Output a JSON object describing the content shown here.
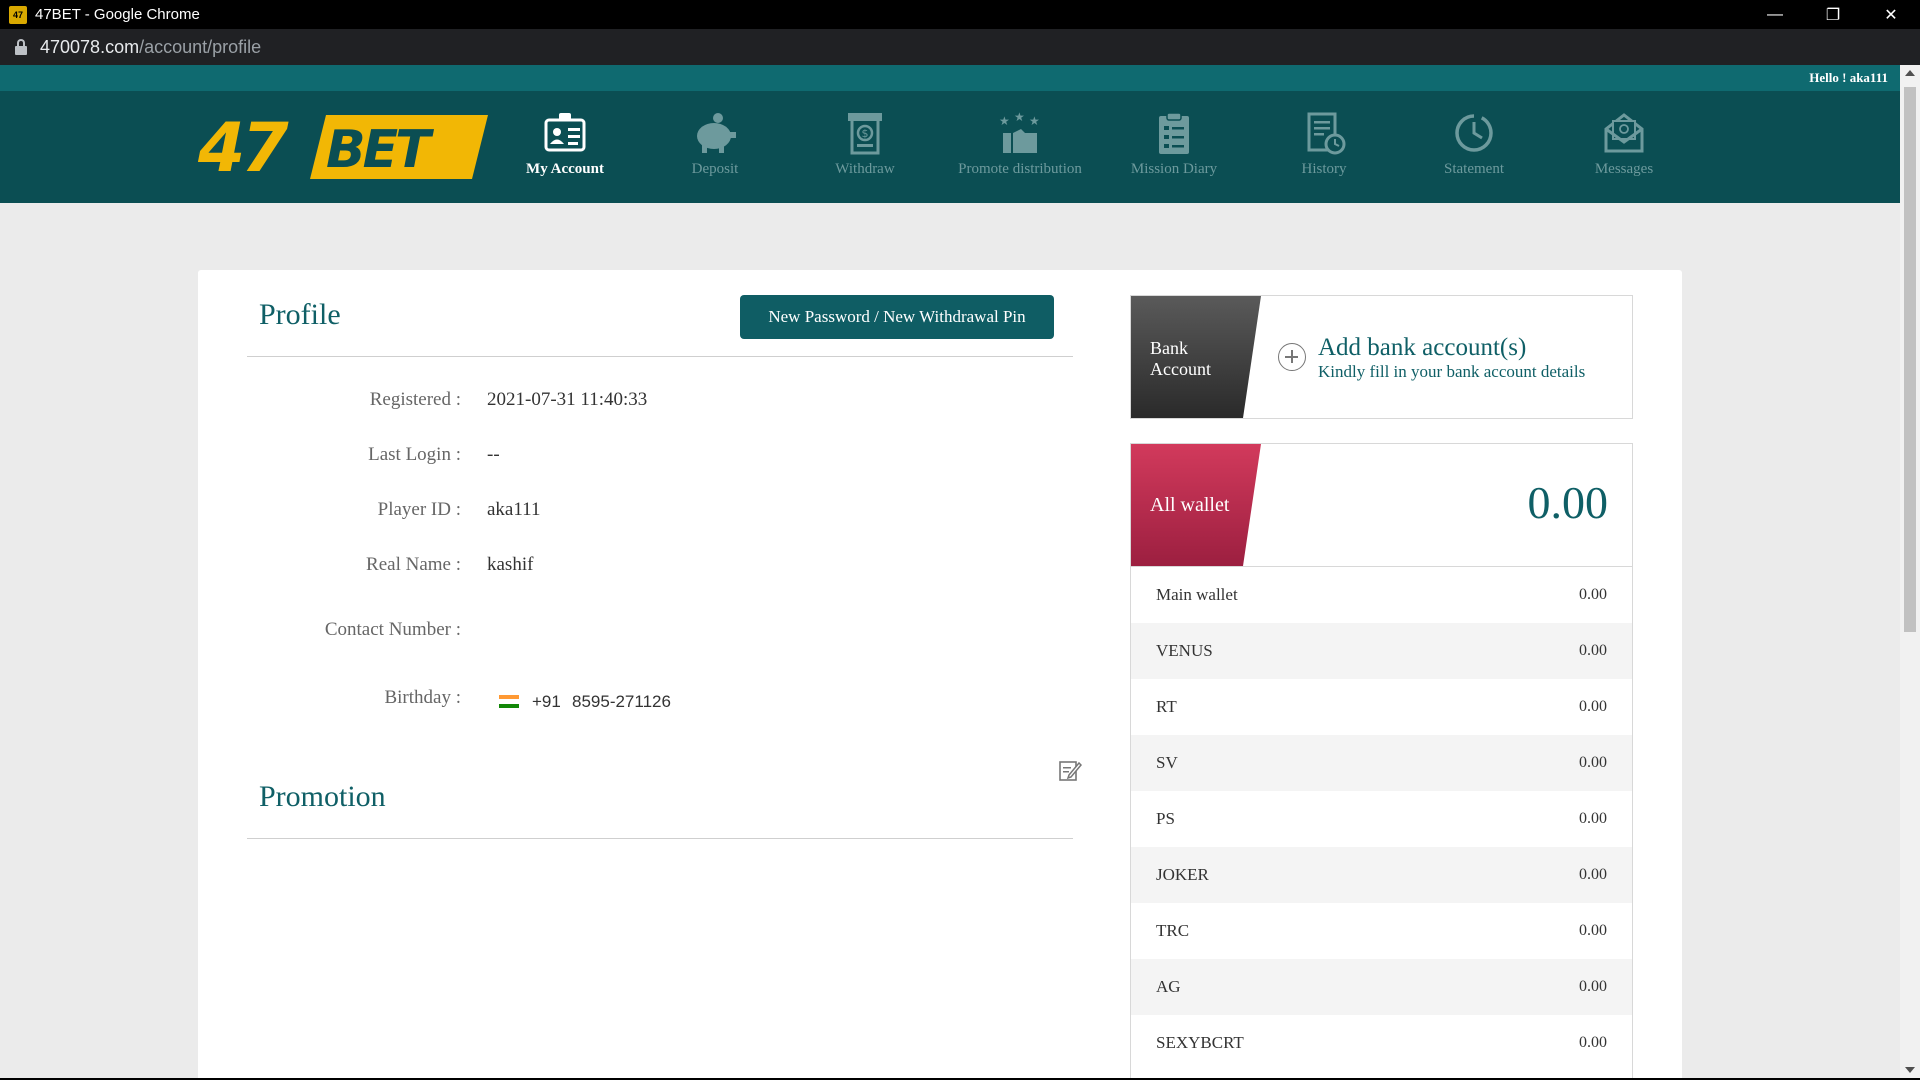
{
  "window": {
    "title": "47BET - Google Chrome",
    "favicon_text": "47",
    "url_host": "470078.com",
    "url_path": "/account/profile"
  },
  "header": {
    "greeting": "Hello ! aka111",
    "logo_text": "47BET",
    "nav": [
      {
        "label": "My Account",
        "icon": "id-card-icon",
        "active": true
      },
      {
        "label": "Deposit",
        "icon": "piggy-bank-icon",
        "active": false
      },
      {
        "label": "Withdraw",
        "icon": "withdraw-cash-icon",
        "active": false
      },
      {
        "label": "Promote distribution",
        "icon": "promote-stars-icon",
        "active": false
      },
      {
        "label": "Mission Diary",
        "icon": "clipboard-checklist-icon",
        "active": false
      },
      {
        "label": "History",
        "icon": "document-clock-icon",
        "active": false
      },
      {
        "label": "Statement",
        "icon": "clock-icon",
        "active": false
      },
      {
        "label": "Messages",
        "icon": "envelope-icon",
        "active": false
      }
    ]
  },
  "profile": {
    "title": "Profile",
    "change_button": "New Password / New Withdrawal Pin",
    "fields": [
      {
        "label": "Registered :",
        "value": "2021-07-31 11:40:33"
      },
      {
        "label": "Last Login :",
        "value": "--"
      },
      {
        "label": "Player ID :",
        "value": "aka111"
      },
      {
        "label": "Real Name :",
        "value": "kashif"
      },
      {
        "label": "Contact Number :",
        "country_code": "+91",
        "value": "8595-271126"
      },
      {
        "label": "Birthday :",
        "value": ""
      }
    ]
  },
  "promotion": {
    "title": "Promotion"
  },
  "bank": {
    "tab_line1": "Bank",
    "tab_line2": "Account",
    "add_title": "Add bank account(s)",
    "add_subtitle": "Kindly fill in your bank account details"
  },
  "wallet": {
    "tab_label": "All wallet",
    "total": "0.00",
    "rows": [
      {
        "name": "Main wallet",
        "value": "0.00"
      },
      {
        "name": "VENUS",
        "value": "0.00"
      },
      {
        "name": "RT",
        "value": "0.00"
      },
      {
        "name": "SV",
        "value": "0.00"
      },
      {
        "name": "PS",
        "value": "0.00"
      },
      {
        "name": "JOKER",
        "value": "0.00"
      },
      {
        "name": "TRC",
        "value": "0.00"
      },
      {
        "name": "AG",
        "value": "0.00"
      },
      {
        "name": "SEXYBCRT",
        "value": "0.00"
      }
    ]
  },
  "colors": {
    "brand_teal": "#0b4e53",
    "accent_teal": "#0f5f66",
    "logo_yellow": "#f2b705",
    "wallet_red": "#b8284a",
    "bank_gray": "#3b3b3b"
  }
}
